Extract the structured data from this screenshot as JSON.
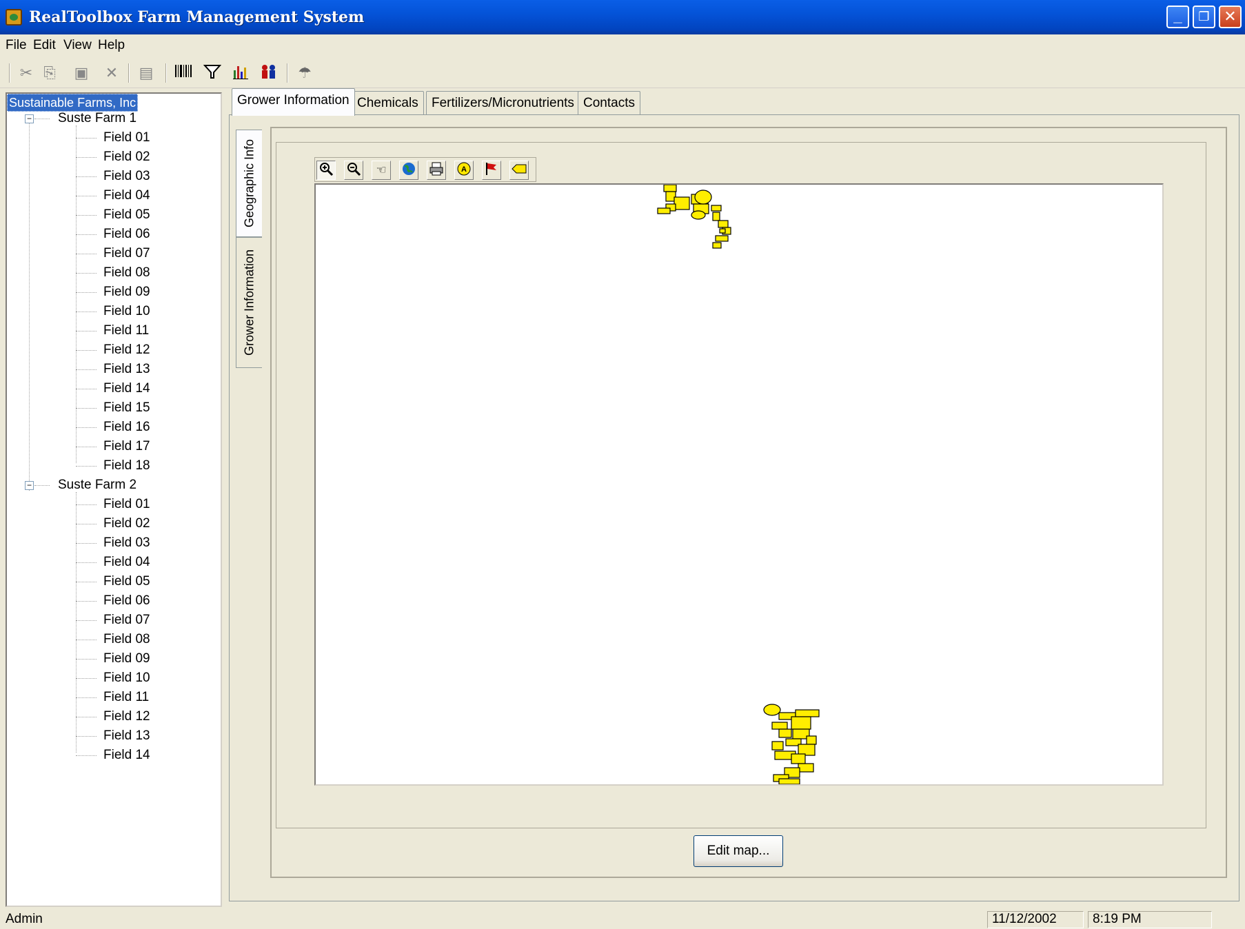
{
  "window": {
    "title": "RealToolbox Farm Management System",
    "minimize_glyph": "_",
    "maximize_glyph": "❐",
    "close_glyph": "✕"
  },
  "menu": {
    "items": [
      "File",
      "Edit",
      "View",
      "Help"
    ]
  },
  "toolbar": {
    "icons": [
      "cut-icon",
      "copy-icon",
      "paste-icon",
      "delete-icon",
      "properties-icon",
      "barcode-icon",
      "filter-icon",
      "chart-icon",
      "people-icon",
      "weather-icon"
    ]
  },
  "tree": {
    "root": "Sustainable Farms, Inc",
    "farms": [
      {
        "name": "Suste Farm 1",
        "fields": [
          "Field 01",
          "Field 02",
          "Field 03",
          "Field 04",
          "Field 05",
          "Field 06",
          "Field 07",
          "Field 08",
          "Field 09",
          "Field 10",
          "Field 11",
          "Field 12",
          "Field 13",
          "Field 14",
          "Field 15",
          "Field 16",
          "Field 17",
          "Field 18"
        ]
      },
      {
        "name": "Suste Farm 2",
        "fields": [
          "Field 01",
          "Field 02",
          "Field 03",
          "Field 04",
          "Field 05",
          "Field 06",
          "Field 07",
          "Field 08",
          "Field 09",
          "Field 10",
          "Field 11",
          "Field 12",
          "Field 13",
          "Field 14"
        ]
      }
    ]
  },
  "tabs": {
    "items": [
      "Grower Information",
      "Chemicals",
      "Fertilizers/Micronutrients",
      "Contacts"
    ],
    "active": "Grower Information"
  },
  "side_tabs": {
    "geographic": "Geographic Info",
    "grower": "Grower Information",
    "active": "Geographic Info"
  },
  "map_tools": [
    "zoom-in-icon",
    "zoom-out-icon",
    "pan-hand-icon",
    "globe-icon",
    "print-icon",
    "label-icon",
    "flag-icon",
    "tag-icon"
  ],
  "map": {
    "field_color": "#ffee00",
    "field_outline": "#000000"
  },
  "buttons": {
    "edit_map": "Edit map..."
  },
  "status": {
    "user": "Admin",
    "date": "11/12/2002",
    "time": "8:19 PM"
  },
  "colors": {
    "titlebar": "#0453d8",
    "selection": "#316ac5",
    "face": "#ece9d8"
  }
}
